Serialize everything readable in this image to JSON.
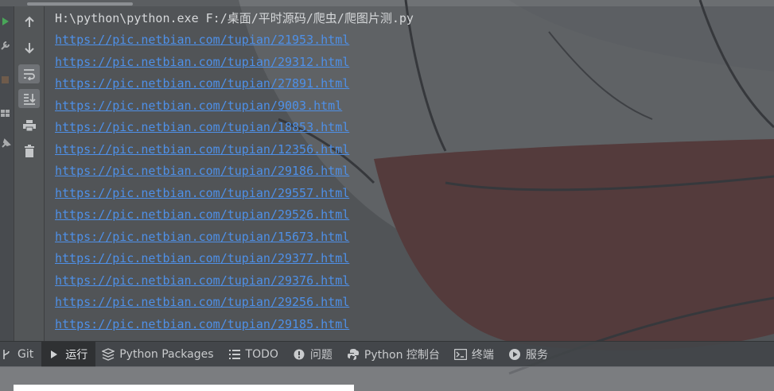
{
  "console": {
    "command": "H:\\python\\python.exe F:/桌面/平时源码/爬虫/爬图片测.py",
    "links": [
      "https://pic.netbian.com/tupian/21953.html",
      "https://pic.netbian.com/tupian/29312.html",
      "https://pic.netbian.com/tupian/27891.html",
      "https://pic.netbian.com/tupian/9003.html",
      "https://pic.netbian.com/tupian/18853.html",
      "https://pic.netbian.com/tupian/12356.html",
      "https://pic.netbian.com/tupian/29186.html",
      "https://pic.netbian.com/tupian/29557.html",
      "https://pic.netbian.com/tupian/29526.html",
      "https://pic.netbian.com/tupian/15673.html",
      "https://pic.netbian.com/tupian/29377.html",
      "https://pic.netbian.com/tupian/29376.html",
      "https://pic.netbian.com/tupian/29256.html",
      "https://pic.netbian.com/tupian/29185.html"
    ],
    "link_color": "#4e90e8",
    "text_color": "#d6d8da"
  },
  "toolbar": {
    "buttons": [
      {
        "name": "up-arrow-icon"
      },
      {
        "name": "down-arrow-icon"
      },
      {
        "name": "soft-wrap-icon"
      },
      {
        "name": "scroll-to-end-icon"
      },
      {
        "name": "print-icon"
      },
      {
        "name": "trash-icon"
      }
    ]
  },
  "bottom_tabs": [
    {
      "label": "Git",
      "icon": "git-branch-icon"
    },
    {
      "label": "运行",
      "icon": "run-icon"
    },
    {
      "label": "Python Packages",
      "icon": "packages-icon"
    },
    {
      "label": "TODO",
      "icon": "list-icon"
    },
    {
      "label": "问题",
      "icon": "problems-icon"
    },
    {
      "label": "Python 控制台",
      "icon": "python-console-icon"
    },
    {
      "label": "终端",
      "icon": "terminal-icon"
    },
    {
      "label": "服务",
      "icon": "services-icon"
    }
  ]
}
